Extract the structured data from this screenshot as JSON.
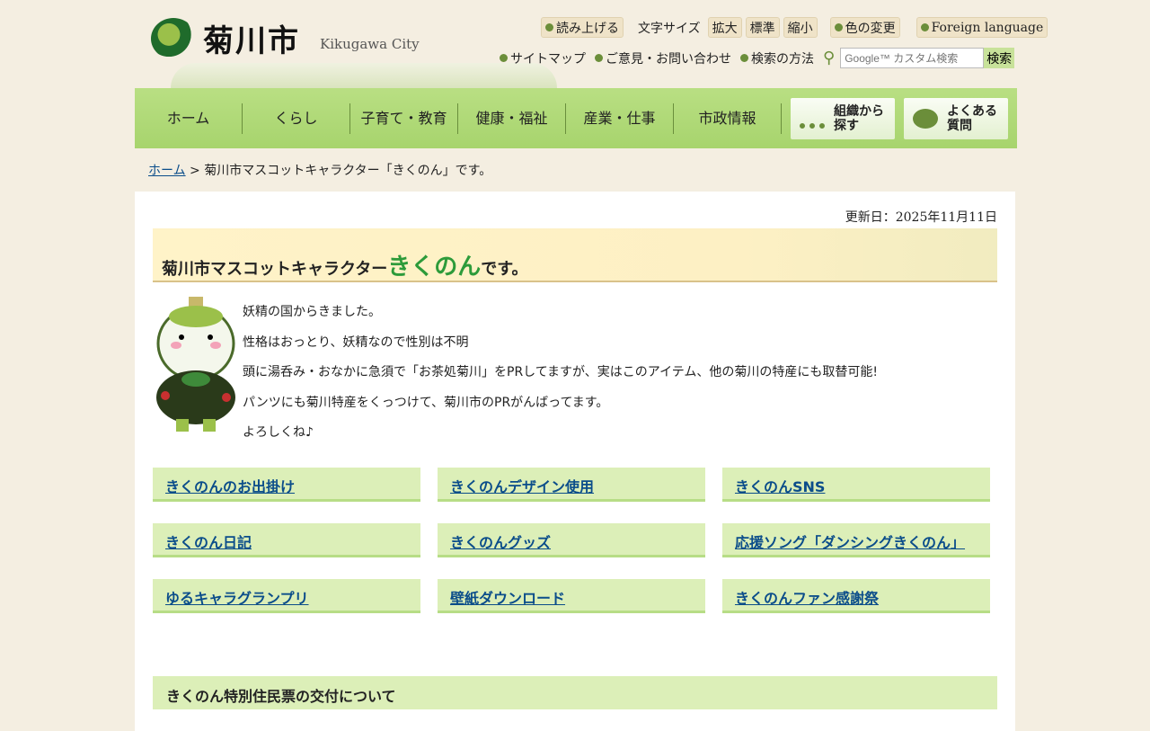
{
  "header": {
    "logo_jp": "菊川市",
    "logo_en": "Kikugawa City",
    "read_aloud": "読み上げる",
    "font_size_label": "文字サイズ",
    "font_large": "拡大",
    "font_standard": "標準",
    "font_small": "縮小",
    "color_change": "色の変更",
    "foreign": "Foreign language",
    "sitemap": "サイトマップ",
    "opinion": "ご意見・お問い合わせ",
    "search_method": "検索の方法",
    "search_placeholder": "Google™ カスタム検索",
    "search_button": "検索"
  },
  "nav": {
    "items": [
      "ホーム",
      "くらし",
      "子育て・教育",
      "健康・福祉",
      "産業・仕事",
      "市政情報"
    ],
    "org": "組織から\n探す",
    "faq": "よくある\n質問"
  },
  "breadcrumb": {
    "home": "ホーム",
    "sep": ">",
    "current": "菊川市マスコットキャラクター「きくのん」です。"
  },
  "page": {
    "updated": "更新日：2025年11月11日",
    "title_pre": "菊川市マスコットキャラクター",
    "title_logo": "きくのん",
    "title_post": "です。",
    "description": [
      "妖精の国からきました。",
      "性格はおっとり、妖精なので性別は不明",
      "頭に湯呑み・おなかに急須で「お茶処菊川」をPRしてますが、実はこのアイテム、他の菊川の特産にも取替可能!",
      "パンツにも菊川特産をくっつけて、菊川市のPRがんばってます。",
      "よろしくね♪"
    ],
    "links": [
      "きくのんのお出掛け",
      "きくのんデザイン使用",
      "きくのんSNS",
      "きくのん日記",
      "きくのんグッズ",
      "応援ソング「ダンシングきくのん」",
      "ゆるキャラグランプリ",
      "壁紙ダウンロード",
      "きくのんファン感謝祭"
    ],
    "section_title": "きくのん特別住民票の交付について"
  },
  "colors": {
    "nav_green": "#a7d46d",
    "link_bg": "#dcefb8",
    "link_text": "#0b4d8a"
  }
}
